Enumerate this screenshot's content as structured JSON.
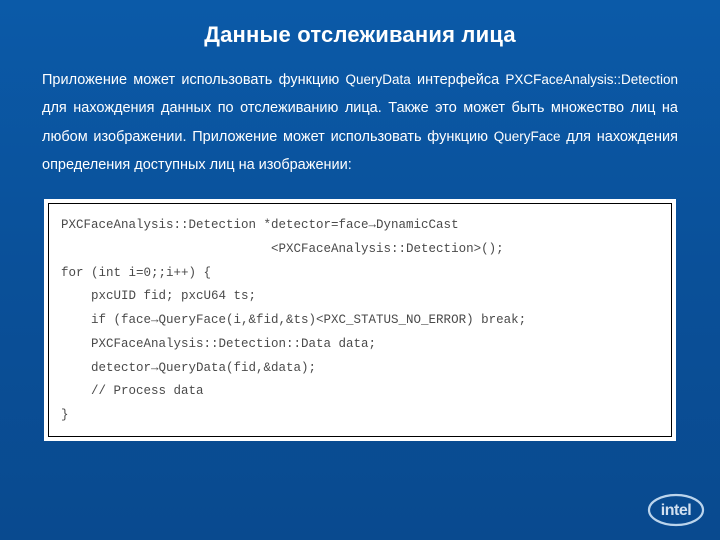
{
  "slide": {
    "title": "Данные отслеживания лица",
    "paragraph": {
      "p1a": "Приложение может использовать функцию ",
      "api1": "QueryData",
      "p1b": " интерфейса ",
      "api2": "PXCFaceAnalysis::Detection",
      "p1c": " для нахождения данных по отслеживанию лица. Также это может быть множество лиц на любом изображении. Приложение может использовать функцию ",
      "api3": "QueryFace",
      "p1d": " для нахождения определения доступных лиц на изображении:"
    },
    "code": "PXCFaceAnalysis::Detection *detector=face→DynamicCast\n                            <PXCFaceAnalysis::Detection>();\nfor (int i=0;;i++) {\n    pxcUID fid; pxcU64 ts;\n    if (face→QueryFace(i,&fid,&ts)<PXC_STATUS_NO_ERROR) break;\n    PXCFaceAnalysis::Detection::Data data;\n    detector→QueryData(fid,&data);\n    // Process data\n}"
  },
  "logo": {
    "text": "intel"
  }
}
